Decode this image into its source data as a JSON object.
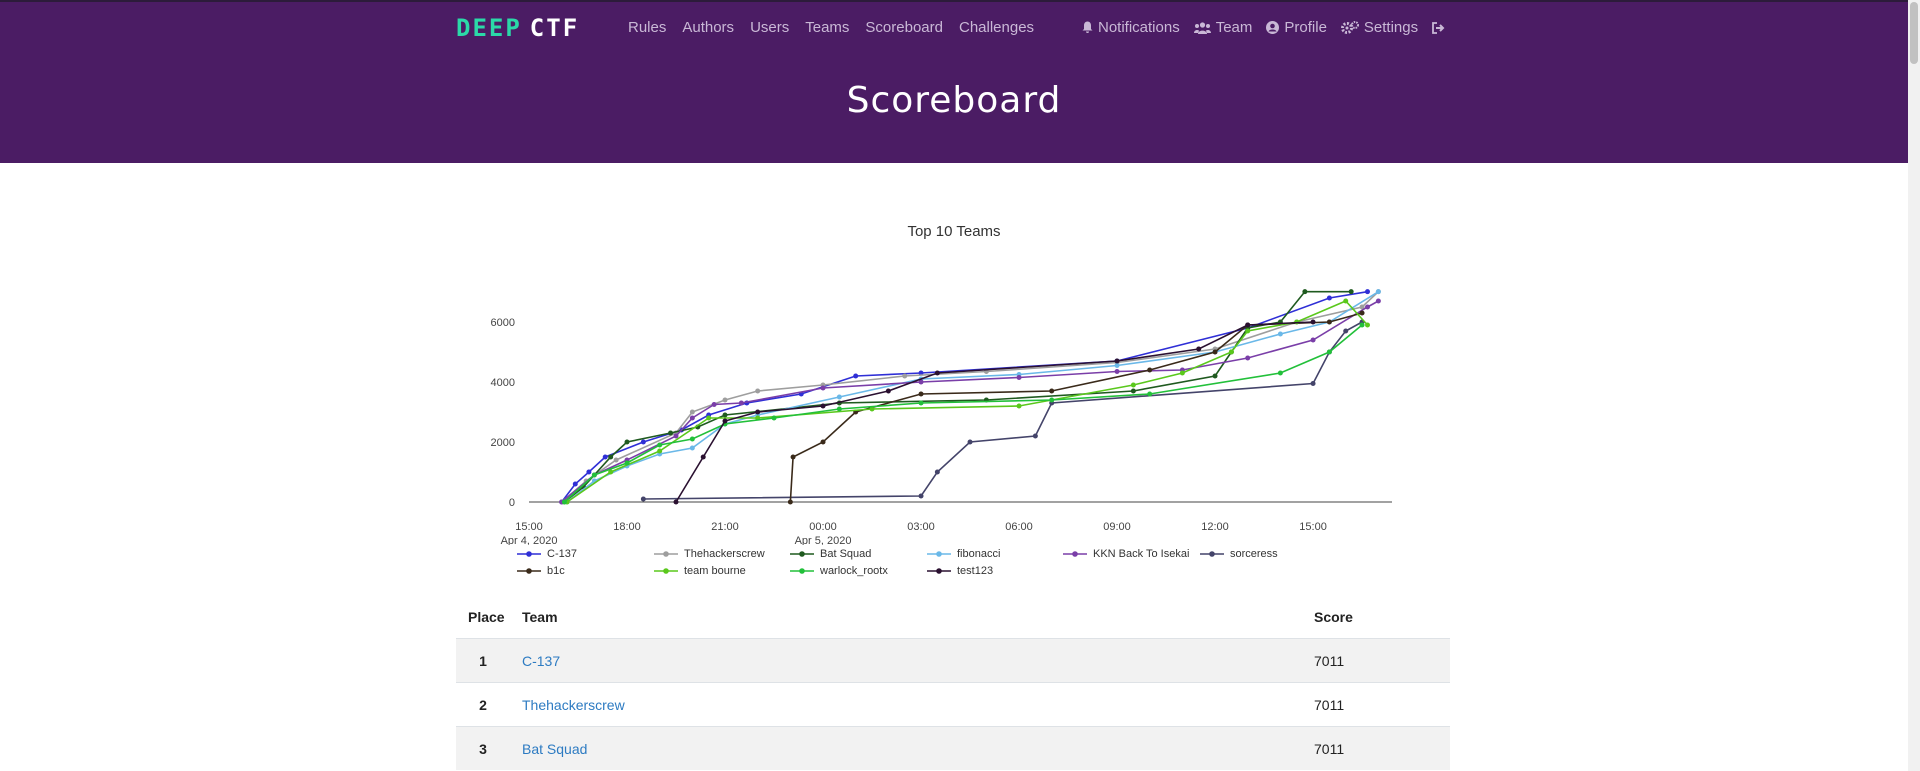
{
  "brand": {
    "logo_part1": "DEEP",
    "logo_part2": "CTF",
    "accent": "#4b1c64",
    "logo_accent": "#2bd9a8"
  },
  "nav": {
    "left": [
      "Rules",
      "Authors",
      "Users",
      "Teams",
      "Scoreboard",
      "Challenges"
    ],
    "right": [
      {
        "label": "Notifications",
        "icon": "bell-icon"
      },
      {
        "label": "Team",
        "icon": "users-icon"
      },
      {
        "label": "Profile",
        "icon": "user-circle-icon"
      },
      {
        "label": "Settings",
        "icon": "gears-icon"
      },
      {
        "label": "",
        "icon": "sign-out-icon"
      }
    ]
  },
  "page": {
    "title": "Scoreboard"
  },
  "chart_data": {
    "type": "line",
    "title": "Top 10 Teams",
    "xlabel": "",
    "ylabel": "",
    "ylim": [
      0,
      7400
    ],
    "y_ticks": [
      0,
      2000,
      4000,
      6000
    ],
    "x_ticks": [
      {
        "t": "2020-04-04 15:00",
        "label": "15:00",
        "sub": "Apr 4, 2020"
      },
      {
        "t": "2020-04-04 18:00",
        "label": "18:00",
        "sub": ""
      },
      {
        "t": "2020-04-04 21:00",
        "label": "21:00",
        "sub": ""
      },
      {
        "t": "2020-04-05 00:00",
        "label": "00:00",
        "sub": "Apr 5, 2020"
      },
      {
        "t": "2020-04-05 03:00",
        "label": "03:00",
        "sub": ""
      },
      {
        "t": "2020-04-05 06:00",
        "label": "06:00",
        "sub": ""
      },
      {
        "t": "2020-04-05 09:00",
        "label": "09:00",
        "sub": ""
      },
      {
        "t": "2020-04-05 12:00",
        "label": "12:00",
        "sub": ""
      },
      {
        "t": "2020-04-05 15:00",
        "label": "15:00",
        "sub": ""
      }
    ],
    "xlim": [
      "2020-04-04 15:00",
      "2020-04-05 17:25"
    ],
    "legend_position": "bottom",
    "series": [
      {
        "name": "C-137",
        "color": "#2f2fd6",
        "points": [
          [
            "2020-04-04 16:00",
            0
          ],
          [
            "2020-04-04 16:25",
            600
          ],
          [
            "2020-04-04 16:50",
            1000
          ],
          [
            "2020-04-04 17:20",
            1500
          ],
          [
            "2020-04-04 18:30",
            2000
          ],
          [
            "2020-04-04 19:40",
            2400
          ],
          [
            "2020-04-04 20:30",
            2900
          ],
          [
            "2020-04-04 21:40",
            3300
          ],
          [
            "2020-04-04 23:20",
            3600
          ],
          [
            "2020-04-05 01:00",
            4200
          ],
          [
            "2020-04-05 03:00",
            4300
          ],
          [
            "2020-04-05 09:00",
            4700
          ],
          [
            "2020-04-05 13:00",
            5800
          ],
          [
            "2020-04-05 15:30",
            6800
          ],
          [
            "2020-04-05 16:40",
            7011
          ]
        ]
      },
      {
        "name": "Thehackerscrew",
        "color": "#9e9e9e",
        "points": [
          [
            "2020-04-04 16:00",
            0
          ],
          [
            "2020-04-04 16:45",
            700
          ],
          [
            "2020-04-04 17:40",
            1400
          ],
          [
            "2020-04-04 19:30",
            2300
          ],
          [
            "2020-04-04 20:00",
            3000
          ],
          [
            "2020-04-04 21:00",
            3400
          ],
          [
            "2020-04-04 22:00",
            3700
          ],
          [
            "2020-04-05 00:00",
            3900
          ],
          [
            "2020-04-05 02:30",
            4200
          ],
          [
            "2020-04-05 05:00",
            4350
          ],
          [
            "2020-04-05 09:00",
            4650
          ],
          [
            "2020-04-05 12:00",
            5100
          ],
          [
            "2020-04-05 14:30",
            6000
          ],
          [
            "2020-04-05 16:30",
            6500
          ],
          [
            "2020-04-05 17:00",
            7011
          ]
        ]
      },
      {
        "name": "Bat Squad",
        "color": "#1f5a1f",
        "points": [
          [
            "2020-04-04 16:05",
            0
          ],
          [
            "2020-04-04 16:40",
            500
          ],
          [
            "2020-04-04 17:30",
            1500
          ],
          [
            "2020-04-04 18:00",
            2000
          ],
          [
            "2020-04-04 19:20",
            2300
          ],
          [
            "2020-04-04 20:10",
            2500
          ],
          [
            "2020-04-04 21:00",
            2900
          ],
          [
            "2020-04-05 00:30",
            3300
          ],
          [
            "2020-04-05 05:00",
            3400
          ],
          [
            "2020-04-05 09:30",
            3700
          ],
          [
            "2020-04-05 12:00",
            4200
          ],
          [
            "2020-04-05 12:30",
            5000
          ],
          [
            "2020-04-05 13:00",
            5800
          ],
          [
            "2020-04-05 14:00",
            6000
          ],
          [
            "2020-04-05 14:45",
            7011
          ],
          [
            "2020-04-05 16:10",
            7011
          ]
        ]
      },
      {
        "name": "fibonacci",
        "color": "#6ab8e8",
        "points": [
          [
            "2020-04-04 16:10",
            0
          ],
          [
            "2020-04-04 17:00",
            700
          ],
          [
            "2020-04-04 18:00",
            1200
          ],
          [
            "2020-04-04 19:00",
            1600
          ],
          [
            "2020-04-04 20:00",
            1800
          ],
          [
            "2020-04-04 21:00",
            2600
          ],
          [
            "2020-04-04 22:00",
            2900
          ],
          [
            "2020-04-05 00:30",
            3500
          ],
          [
            "2020-04-05 03:00",
            4100
          ],
          [
            "2020-04-05 06:00",
            4250
          ],
          [
            "2020-04-05 09:00",
            4550
          ],
          [
            "2020-04-05 12:00",
            5000
          ],
          [
            "2020-04-05 14:00",
            5600
          ],
          [
            "2020-04-05 15:30",
            6000
          ],
          [
            "2020-04-05 17:00",
            7011
          ]
        ]
      },
      {
        "name": "KKN Back To Isekai",
        "color": "#7a3ea8",
        "points": [
          [
            "2020-04-04 16:00",
            0
          ],
          [
            "2020-04-04 17:00",
            900
          ],
          [
            "2020-04-04 18:00",
            1400
          ],
          [
            "2020-04-04 19:30",
            2200
          ],
          [
            "2020-04-04 20:00",
            2800
          ],
          [
            "2020-04-04 20:40",
            3250
          ],
          [
            "2020-04-04 21:30",
            3300
          ],
          [
            "2020-04-05 00:00",
            3800
          ],
          [
            "2020-04-05 03:00",
            4000
          ],
          [
            "2020-04-05 06:00",
            4150
          ],
          [
            "2020-04-05 09:00",
            4350
          ],
          [
            "2020-04-05 11:00",
            4400
          ],
          [
            "2020-04-05 13:00",
            4800
          ],
          [
            "2020-04-05 15:00",
            5400
          ],
          [
            "2020-04-05 16:40",
            6500
          ],
          [
            "2020-04-05 17:00",
            6700
          ]
        ]
      },
      {
        "name": "sorceress",
        "color": "#44446a",
        "points": [
          [
            "2020-04-04 18:30",
            100
          ],
          [
            "2020-04-05 03:00",
            200
          ],
          [
            "2020-04-05 03:30",
            1000
          ],
          [
            "2020-04-05 04:30",
            2000
          ],
          [
            "2020-04-05 06:30",
            2200
          ],
          [
            "2020-04-05 07:00",
            3300
          ],
          [
            "2020-04-05 15:00",
            3950
          ],
          [
            "2020-04-05 15:30",
            5000
          ],
          [
            "2020-04-05 16:00",
            5700
          ],
          [
            "2020-04-05 16:30",
            6000
          ]
        ]
      },
      {
        "name": "b1c",
        "color": "#3a2a1a",
        "points": [
          [
            "2020-04-04 23:00",
            0
          ],
          [
            "2020-04-04 23:05",
            1500
          ],
          [
            "2020-04-05 00:00",
            2000
          ],
          [
            "2020-04-05 01:00",
            3000
          ],
          [
            "2020-04-05 03:00",
            3600
          ],
          [
            "2020-04-05 07:00",
            3700
          ],
          [
            "2020-04-05 10:00",
            4400
          ],
          [
            "2020-04-05 12:00",
            5000
          ],
          [
            "2020-04-05 13:00",
            5900
          ],
          [
            "2020-04-05 15:30",
            6000
          ],
          [
            "2020-04-05 16:30",
            6300
          ]
        ]
      },
      {
        "name": "team bourne",
        "color": "#5ac81c",
        "points": [
          [
            "2020-04-04 16:10",
            0
          ],
          [
            "2020-04-04 17:30",
            1000
          ],
          [
            "2020-04-04 19:00",
            1700
          ],
          [
            "2020-04-04 20:30",
            2800
          ],
          [
            "2020-04-04 22:00",
            2800
          ],
          [
            "2020-04-05 01:30",
            3100
          ],
          [
            "2020-04-05 06:00",
            3200
          ],
          [
            "2020-04-05 09:30",
            3900
          ],
          [
            "2020-04-05 11:00",
            4300
          ],
          [
            "2020-04-05 12:30",
            5000
          ],
          [
            "2020-04-05 13:00",
            5700
          ],
          [
            "2020-04-05 14:30",
            6000
          ],
          [
            "2020-04-05 16:00",
            6700
          ],
          [
            "2020-04-05 16:40",
            5900
          ]
        ]
      },
      {
        "name": "warlock_rootx",
        "color": "#22c03a",
        "points": [
          [
            "2020-04-04 16:05",
            0
          ],
          [
            "2020-04-04 17:00",
            900
          ],
          [
            "2020-04-04 18:00",
            1300
          ],
          [
            "2020-04-04 19:00",
            1900
          ],
          [
            "2020-04-04 20:00",
            2100
          ],
          [
            "2020-04-04 21:00",
            2600
          ],
          [
            "2020-04-04 22:30",
            2800
          ],
          [
            "2020-04-05 00:30",
            3100
          ],
          [
            "2020-04-05 03:00",
            3300
          ],
          [
            "2020-04-05 07:00",
            3400
          ],
          [
            "2020-04-05 10:00",
            3600
          ],
          [
            "2020-04-05 14:00",
            4300
          ],
          [
            "2020-04-05 15:30",
            5000
          ],
          [
            "2020-04-05 16:30",
            5900
          ]
        ]
      },
      {
        "name": "test123",
        "color": "#2a1030",
        "points": [
          [
            "2020-04-04 19:30",
            0
          ],
          [
            "2020-04-04 20:20",
            1500
          ],
          [
            "2020-04-04 21:00",
            2700
          ],
          [
            "2020-04-04 22:00",
            3000
          ],
          [
            "2020-04-05 00:00",
            3200
          ],
          [
            "2020-04-05 02:00",
            3700
          ],
          [
            "2020-04-05 03:30",
            4300
          ],
          [
            "2020-04-05 09:00",
            4700
          ],
          [
            "2020-04-05 11:30",
            5100
          ],
          [
            "2020-04-05 13:00",
            5900
          ],
          [
            "2020-04-05 15:00",
            6000
          ]
        ]
      }
    ]
  },
  "table": {
    "headers": [
      "Place",
      "Team",
      "Score"
    ],
    "rows": [
      {
        "place": "1",
        "team": "C-137",
        "score": "7011"
      },
      {
        "place": "2",
        "team": "Thehackerscrew",
        "score": "7011"
      },
      {
        "place": "3",
        "team": "Bat Squad",
        "score": "7011"
      }
    ]
  }
}
